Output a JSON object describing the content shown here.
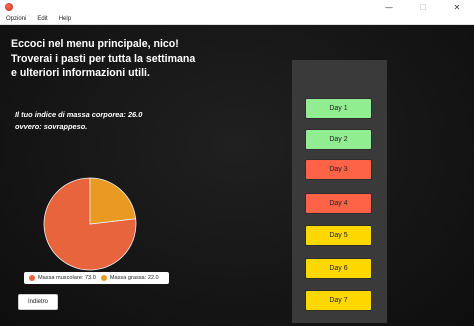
{
  "window": {
    "icon": "tomato-icon",
    "controls": {
      "minimize": "—",
      "maximize": "☐",
      "close": "✕"
    }
  },
  "menubar": {
    "items": [
      "Opzioni",
      "Edit",
      "Help"
    ]
  },
  "main": {
    "welcome_lines": [
      "Eccoci nel menu principale, nico!",
      "Troverai i pasti per tutta la settimana",
      "e ulteriori informazioni utili."
    ],
    "bmi_lines": [
      "Il tuo indice di massa corporea: 26.0",
      "ovvero: sovrappeso."
    ],
    "back_label": "Indietro"
  },
  "chart_data": {
    "type": "pie",
    "series": [
      {
        "name": "Massa muscolare",
        "value": 73.0,
        "color": "#e8643c"
      },
      {
        "name": "Massa grassa",
        "value": 22.0,
        "color": "#e89a22"
      }
    ],
    "legend_labels": [
      "Massa muscolare: 73.0",
      "Massa grassa: 22.0"
    ],
    "legend_position": "bottom"
  },
  "days": [
    {
      "label": "Day 1",
      "color": "#90ee90"
    },
    {
      "label": "Day 2",
      "color": "#90ee90"
    },
    {
      "label": "Day 3",
      "color": "#ff6347"
    },
    {
      "label": "Day 4",
      "color": "#ff6347"
    },
    {
      "label": "Day 5",
      "color": "#ffd700"
    },
    {
      "label": "Day 6",
      "color": "#ffd700"
    },
    {
      "label": "Day 7",
      "color": "#ffd700"
    }
  ]
}
